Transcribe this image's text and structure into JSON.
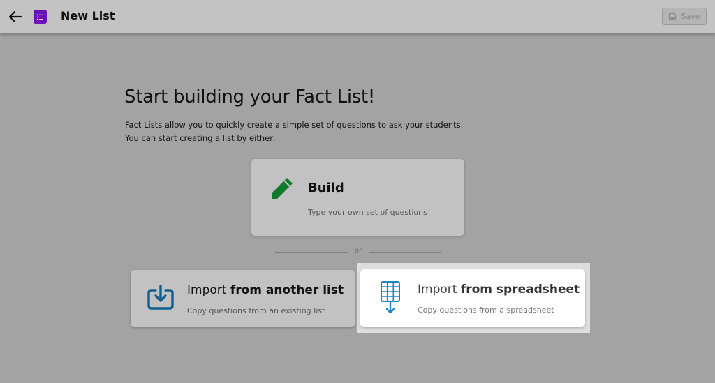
{
  "header": {
    "back_icon": "arrow-left-icon",
    "app_icon": "list-document-icon",
    "app_icon_color": "#6a14b8",
    "title": "New List",
    "save_label": "Save",
    "save_icon": "save-disk-icon"
  },
  "main": {
    "heading": "Start building your Fact List!",
    "intro_line1": "Fact Lists allow you to quickly create a simple set of questions to ask your students.",
    "intro_line2": "You can start creating a list by either:",
    "divider_text": "or",
    "options": {
      "build": {
        "icon": "pencil-icon",
        "icon_color": "#0f7a2e",
        "title": "Build",
        "description": "Type your own set of questions"
      },
      "import_list": {
        "icon": "import-tray-icon",
        "icon_color": "#125e8c",
        "title_prefix": "Import ",
        "title_bold": "from another list",
        "description": "Copy questions from an existing list"
      },
      "import_spreadsheet": {
        "icon": "spreadsheet-download-icon",
        "icon_color": "#1a86c4",
        "title_prefix": "Import ",
        "title_bold": "from spreadsheet",
        "description": "Copy questions from a spreadsheet",
        "highlighted": true
      }
    }
  }
}
